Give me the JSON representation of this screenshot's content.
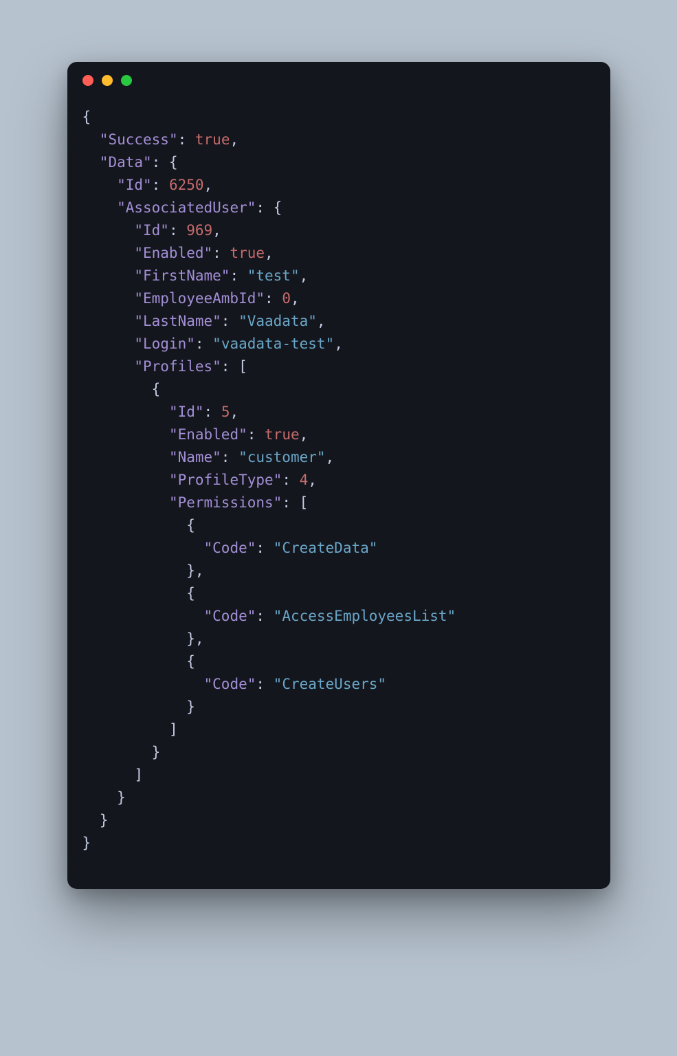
{
  "window": {
    "traffic_lights": [
      "red",
      "yellow",
      "green"
    ]
  },
  "code": {
    "indent": "  ",
    "tokens": [
      [
        [
          "punct",
          "{"
        ]
      ],
      [
        [
          "indent",
          1
        ],
        [
          "key",
          "\"Success\""
        ],
        [
          "punct",
          ": "
        ],
        [
          "bool",
          "true"
        ],
        [
          "punct",
          ","
        ]
      ],
      [
        [
          "indent",
          1
        ],
        [
          "key",
          "\"Data\""
        ],
        [
          "punct",
          ": {"
        ]
      ],
      [
        [
          "indent",
          2
        ],
        [
          "key",
          "\"Id\""
        ],
        [
          "punct",
          ": "
        ],
        [
          "num",
          "6250"
        ],
        [
          "punct",
          ","
        ]
      ],
      [
        [
          "indent",
          2
        ],
        [
          "key",
          "\"AssociatedUser\""
        ],
        [
          "punct",
          ": {"
        ]
      ],
      [
        [
          "indent",
          3
        ],
        [
          "key",
          "\"Id\""
        ],
        [
          "punct",
          ": "
        ],
        [
          "num",
          "969"
        ],
        [
          "punct",
          ","
        ]
      ],
      [
        [
          "indent",
          3
        ],
        [
          "key",
          "\"Enabled\""
        ],
        [
          "punct",
          ": "
        ],
        [
          "bool",
          "true"
        ],
        [
          "punct",
          ","
        ]
      ],
      [
        [
          "indent",
          3
        ],
        [
          "key",
          "\"FirstName\""
        ],
        [
          "punct",
          ": "
        ],
        [
          "string",
          "\"test\""
        ],
        [
          "punct",
          ","
        ]
      ],
      [
        [
          "indent",
          3
        ],
        [
          "key",
          "\"EmployeeAmbId\""
        ],
        [
          "punct",
          ": "
        ],
        [
          "num",
          "0"
        ],
        [
          "punct",
          ","
        ]
      ],
      [
        [
          "indent",
          3
        ],
        [
          "key",
          "\"LastName\""
        ],
        [
          "punct",
          ": "
        ],
        [
          "string",
          "\"Vaadata\""
        ],
        [
          "punct",
          ","
        ]
      ],
      [
        [
          "indent",
          3
        ],
        [
          "key",
          "\"Login\""
        ],
        [
          "punct",
          ": "
        ],
        [
          "string",
          "\"vaadata-test\""
        ],
        [
          "punct",
          ","
        ]
      ],
      [
        [
          "indent",
          3
        ],
        [
          "key",
          "\"Profiles\""
        ],
        [
          "punct",
          ": ["
        ]
      ],
      [
        [
          "indent",
          4
        ],
        [
          "punct",
          "{"
        ]
      ],
      [
        [
          "indent",
          5
        ],
        [
          "key",
          "\"Id\""
        ],
        [
          "punct",
          ": "
        ],
        [
          "num",
          "5"
        ],
        [
          "punct",
          ","
        ]
      ],
      [
        [
          "indent",
          5
        ],
        [
          "key",
          "\"Enabled\""
        ],
        [
          "punct",
          ": "
        ],
        [
          "bool",
          "true"
        ],
        [
          "punct",
          ","
        ]
      ],
      [
        [
          "indent",
          5
        ],
        [
          "key",
          "\"Name\""
        ],
        [
          "punct",
          ": "
        ],
        [
          "string",
          "\"customer\""
        ],
        [
          "punct",
          ","
        ]
      ],
      [
        [
          "indent",
          5
        ],
        [
          "key",
          "\"ProfileType\""
        ],
        [
          "punct",
          ": "
        ],
        [
          "num",
          "4"
        ],
        [
          "punct",
          ","
        ]
      ],
      [
        [
          "indent",
          5
        ],
        [
          "key",
          "\"Permissions\""
        ],
        [
          "punct",
          ": ["
        ]
      ],
      [
        [
          "indent",
          6
        ],
        [
          "punct",
          "{"
        ]
      ],
      [
        [
          "indent",
          7
        ],
        [
          "key",
          "\"Code\""
        ],
        [
          "punct",
          ": "
        ],
        [
          "string",
          "\"CreateData\""
        ]
      ],
      [
        [
          "indent",
          6
        ],
        [
          "punct",
          "},"
        ]
      ],
      [
        [
          "indent",
          6
        ],
        [
          "punct",
          "{"
        ]
      ],
      [
        [
          "indent",
          7
        ],
        [
          "key",
          "\"Code\""
        ],
        [
          "punct",
          ": "
        ],
        [
          "string",
          "\"AccessEmployeesList\""
        ]
      ],
      [
        [
          "indent",
          6
        ],
        [
          "punct",
          "},"
        ]
      ],
      [
        [
          "indent",
          6
        ],
        [
          "punct",
          "{"
        ]
      ],
      [
        [
          "indent",
          7
        ],
        [
          "key",
          "\"Code\""
        ],
        [
          "punct",
          ": "
        ],
        [
          "string",
          "\"CreateUsers\""
        ]
      ],
      [
        [
          "indent",
          6
        ],
        [
          "punct",
          "}"
        ]
      ],
      [
        [
          "indent",
          5
        ],
        [
          "punct",
          "]"
        ]
      ],
      [
        [
          "indent",
          4
        ],
        [
          "punct",
          "}"
        ]
      ],
      [
        [
          "indent",
          3
        ],
        [
          "punct",
          "]"
        ]
      ],
      [
        [
          "indent",
          2
        ],
        [
          "punct",
          "}"
        ]
      ],
      [
        [
          "indent",
          1
        ],
        [
          "punct",
          "}"
        ]
      ],
      [
        [
          "punct",
          "}"
        ]
      ]
    ]
  }
}
